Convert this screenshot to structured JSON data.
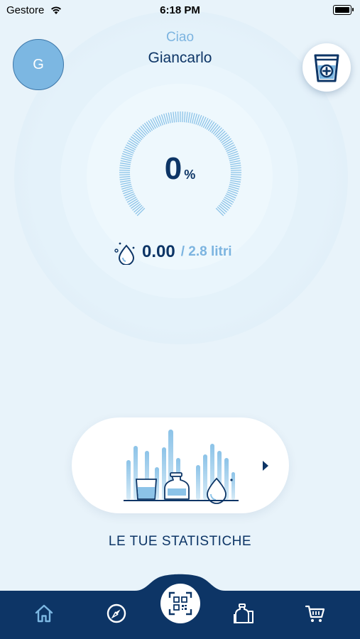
{
  "status_bar": {
    "carrier": "Gestore",
    "time": "6:18 PM"
  },
  "user": {
    "initial": "G",
    "greeting": "Ciao",
    "name": "Giancarlo"
  },
  "progress": {
    "percent_value": "0",
    "percent_unit": "%",
    "fraction": 0
  },
  "intake": {
    "current": "0.00",
    "target": "/ 2.8 litri"
  },
  "stats": {
    "label": "LE TUE STATISTICHE"
  },
  "icons": {
    "add": "add-water-icon",
    "home": "home-icon",
    "compass": "compass-icon",
    "scan": "qr-scan-icon",
    "bottles": "bottles-icon",
    "cart": "cart-icon"
  },
  "colors": {
    "navy": "#0d3566",
    "light_blue": "#7cb4e0",
    "background": "#e8f3fa",
    "tab_bar": "#0d3566"
  }
}
